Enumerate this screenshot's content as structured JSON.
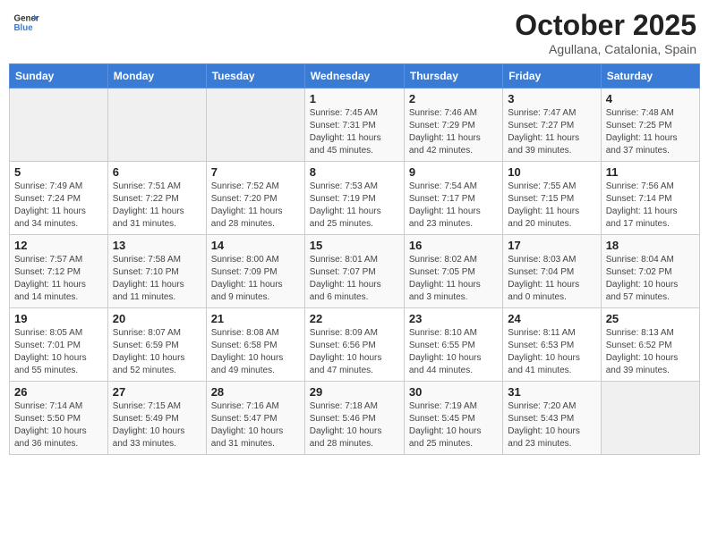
{
  "header": {
    "logo_line1": "General",
    "logo_line2": "Blue",
    "month": "October 2025",
    "location": "Agullana, Catalonia, Spain"
  },
  "days_of_week": [
    "Sunday",
    "Monday",
    "Tuesday",
    "Wednesday",
    "Thursday",
    "Friday",
    "Saturday"
  ],
  "weeks": [
    [
      {
        "day": "",
        "info": ""
      },
      {
        "day": "",
        "info": ""
      },
      {
        "day": "",
        "info": ""
      },
      {
        "day": "1",
        "info": "Sunrise: 7:45 AM\nSunset: 7:31 PM\nDaylight: 11 hours\nand 45 minutes."
      },
      {
        "day": "2",
        "info": "Sunrise: 7:46 AM\nSunset: 7:29 PM\nDaylight: 11 hours\nand 42 minutes."
      },
      {
        "day": "3",
        "info": "Sunrise: 7:47 AM\nSunset: 7:27 PM\nDaylight: 11 hours\nand 39 minutes."
      },
      {
        "day": "4",
        "info": "Sunrise: 7:48 AM\nSunset: 7:25 PM\nDaylight: 11 hours\nand 37 minutes."
      }
    ],
    [
      {
        "day": "5",
        "info": "Sunrise: 7:49 AM\nSunset: 7:24 PM\nDaylight: 11 hours\nand 34 minutes."
      },
      {
        "day": "6",
        "info": "Sunrise: 7:51 AM\nSunset: 7:22 PM\nDaylight: 11 hours\nand 31 minutes."
      },
      {
        "day": "7",
        "info": "Sunrise: 7:52 AM\nSunset: 7:20 PM\nDaylight: 11 hours\nand 28 minutes."
      },
      {
        "day": "8",
        "info": "Sunrise: 7:53 AM\nSunset: 7:19 PM\nDaylight: 11 hours\nand 25 minutes."
      },
      {
        "day": "9",
        "info": "Sunrise: 7:54 AM\nSunset: 7:17 PM\nDaylight: 11 hours\nand 23 minutes."
      },
      {
        "day": "10",
        "info": "Sunrise: 7:55 AM\nSunset: 7:15 PM\nDaylight: 11 hours\nand 20 minutes."
      },
      {
        "day": "11",
        "info": "Sunrise: 7:56 AM\nSunset: 7:14 PM\nDaylight: 11 hours\nand 17 minutes."
      }
    ],
    [
      {
        "day": "12",
        "info": "Sunrise: 7:57 AM\nSunset: 7:12 PM\nDaylight: 11 hours\nand 14 minutes."
      },
      {
        "day": "13",
        "info": "Sunrise: 7:58 AM\nSunset: 7:10 PM\nDaylight: 11 hours\nand 11 minutes."
      },
      {
        "day": "14",
        "info": "Sunrise: 8:00 AM\nSunset: 7:09 PM\nDaylight: 11 hours\nand 9 minutes."
      },
      {
        "day": "15",
        "info": "Sunrise: 8:01 AM\nSunset: 7:07 PM\nDaylight: 11 hours\nand 6 minutes."
      },
      {
        "day": "16",
        "info": "Sunrise: 8:02 AM\nSunset: 7:05 PM\nDaylight: 11 hours\nand 3 minutes."
      },
      {
        "day": "17",
        "info": "Sunrise: 8:03 AM\nSunset: 7:04 PM\nDaylight: 11 hours\nand 0 minutes."
      },
      {
        "day": "18",
        "info": "Sunrise: 8:04 AM\nSunset: 7:02 PM\nDaylight: 10 hours\nand 57 minutes."
      }
    ],
    [
      {
        "day": "19",
        "info": "Sunrise: 8:05 AM\nSunset: 7:01 PM\nDaylight: 10 hours\nand 55 minutes."
      },
      {
        "day": "20",
        "info": "Sunrise: 8:07 AM\nSunset: 6:59 PM\nDaylight: 10 hours\nand 52 minutes."
      },
      {
        "day": "21",
        "info": "Sunrise: 8:08 AM\nSunset: 6:58 PM\nDaylight: 10 hours\nand 49 minutes."
      },
      {
        "day": "22",
        "info": "Sunrise: 8:09 AM\nSunset: 6:56 PM\nDaylight: 10 hours\nand 47 minutes."
      },
      {
        "day": "23",
        "info": "Sunrise: 8:10 AM\nSunset: 6:55 PM\nDaylight: 10 hours\nand 44 minutes."
      },
      {
        "day": "24",
        "info": "Sunrise: 8:11 AM\nSunset: 6:53 PM\nDaylight: 10 hours\nand 41 minutes."
      },
      {
        "day": "25",
        "info": "Sunrise: 8:13 AM\nSunset: 6:52 PM\nDaylight: 10 hours\nand 39 minutes."
      }
    ],
    [
      {
        "day": "26",
        "info": "Sunrise: 7:14 AM\nSunset: 5:50 PM\nDaylight: 10 hours\nand 36 minutes."
      },
      {
        "day": "27",
        "info": "Sunrise: 7:15 AM\nSunset: 5:49 PM\nDaylight: 10 hours\nand 33 minutes."
      },
      {
        "day": "28",
        "info": "Sunrise: 7:16 AM\nSunset: 5:47 PM\nDaylight: 10 hours\nand 31 minutes."
      },
      {
        "day": "29",
        "info": "Sunrise: 7:18 AM\nSunset: 5:46 PM\nDaylight: 10 hours\nand 28 minutes."
      },
      {
        "day": "30",
        "info": "Sunrise: 7:19 AM\nSunset: 5:45 PM\nDaylight: 10 hours\nand 25 minutes."
      },
      {
        "day": "31",
        "info": "Sunrise: 7:20 AM\nSunset: 5:43 PM\nDaylight: 10 hours\nand 23 minutes."
      },
      {
        "day": "",
        "info": ""
      }
    ]
  ]
}
